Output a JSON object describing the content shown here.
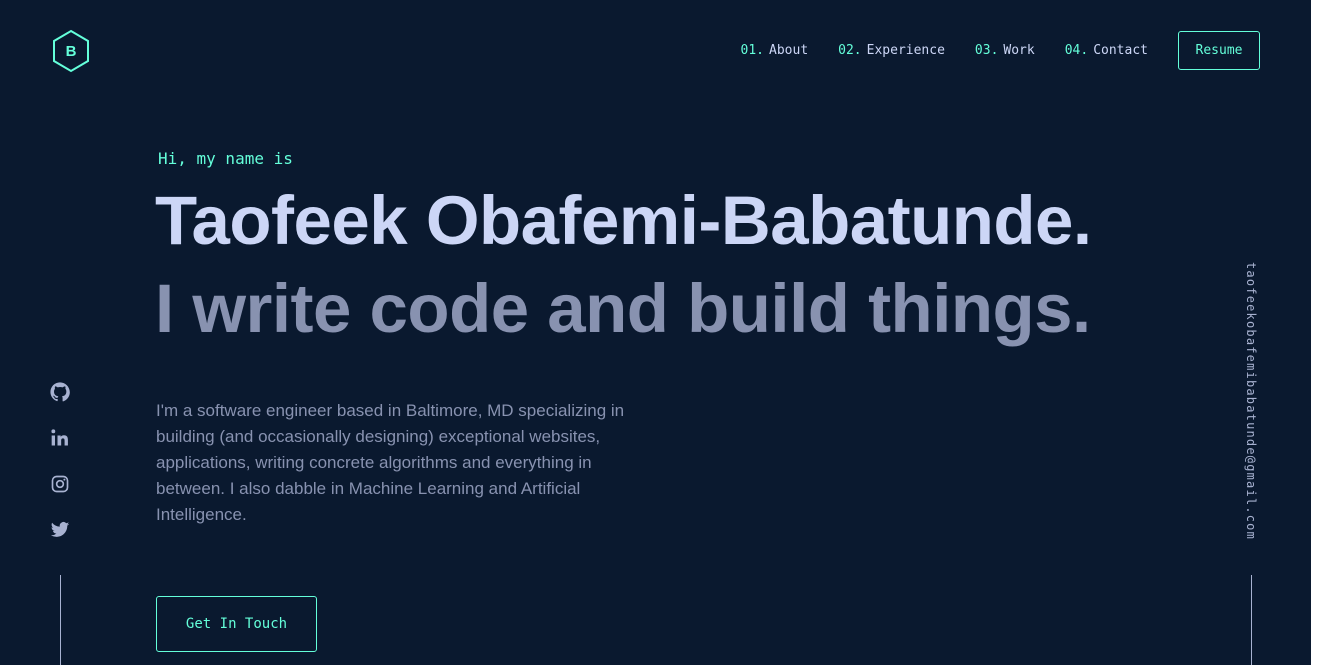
{
  "colors": {
    "background": "#0a192f",
    "accent": "#64ffda",
    "heading": "#ccd6f6",
    "body_text": "#8892b0",
    "side_text": "#a8b2d1"
  },
  "logo": {
    "letter": "B",
    "icon": "hexagon-logo-icon"
  },
  "nav": {
    "items": [
      {
        "num": "01.",
        "label": "About"
      },
      {
        "num": "02.",
        "label": "Experience"
      },
      {
        "num": "03.",
        "label": "Work"
      },
      {
        "num": "04.",
        "label": "Contact"
      }
    ],
    "resume_label": "Resume"
  },
  "hero": {
    "greeting": "Hi, my name is",
    "name": "Taofeek Obafemi-Babatunde.",
    "tagline": "I write code and build things.",
    "bio": "I'm a software engineer based in Baltimore, MD specializing in building (and occasionally designing) exceptional websites, applications, writing concrete algorithms and everything in between. I also dabble in Machine Learning and Artificial Intelligence.",
    "cta_label": "Get In Touch"
  },
  "social": {
    "icons": [
      "github-icon",
      "linkedin-icon",
      "instagram-icon",
      "twitter-icon"
    ]
  },
  "email": "taofeekobafemibabatunde@gmail.com"
}
